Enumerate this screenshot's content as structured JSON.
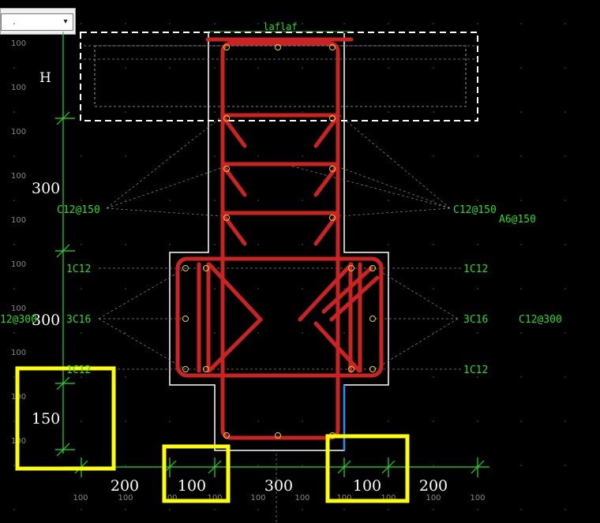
{
  "toolbar": {
    "layer_select": {
      "value": "",
      "arrow_icon": "chevron-down-icon"
    }
  },
  "drawing": {
    "colors": {
      "background": "#000000",
      "rebar": "#cc2222",
      "annotation": "#22dd22",
      "outline": "#ffffff",
      "dimension_text": "#ffffff",
      "highlight": "#ffff00",
      "grid_text": "#888888",
      "rebar_node": "#e8d040"
    },
    "top_label": "laflaf",
    "h_label": "H",
    "vertical_dims": [
      "300",
      "300",
      "150"
    ],
    "horizontal_dims": [
      "200",
      "100",
      "300",
      "100",
      "200"
    ],
    "rebar_labels": {
      "left_c12_150": "C12@150",
      "right_c12_150": "C12@150",
      "a6_150": "A6@150",
      "left_1c12_top": "1C12",
      "right_1c12_top": "1C12",
      "left_3c16": "3C16",
      "right_3c16": "3C16",
      "left_c12_300": "12@300",
      "right_c12_300": "C12@300",
      "left_1c12_bottom": "1C12",
      "right_1c12_bottom": "1C12"
    },
    "grid_label": "100"
  }
}
